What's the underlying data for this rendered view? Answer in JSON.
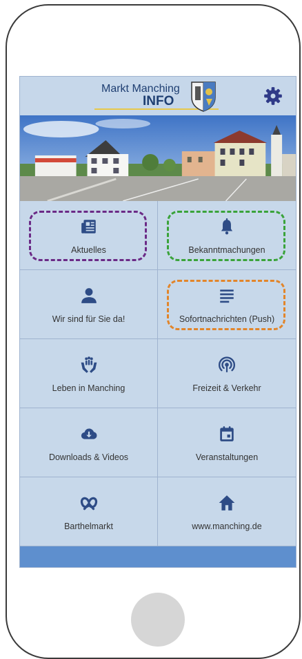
{
  "header": {
    "title_line1": "Markt Manching",
    "title_line2": "INFO"
  },
  "colors": {
    "header_bg": "#c6d7ea",
    "tile_bg": "#c7d8ea",
    "icon_color": "#2e4c86",
    "footer_bar": "#5e8fce",
    "highlight_purple": "#6b2a86",
    "highlight_green": "#3aa33a",
    "highlight_orange": "#e2852a"
  },
  "tiles": [
    {
      "label": "Aktuelles",
      "icon": "newspaper-icon",
      "highlight": "purple"
    },
    {
      "label": "Bekanntmachungen",
      "icon": "bell-icon",
      "highlight": "green"
    },
    {
      "label": "Wir sind für Sie da!",
      "icon": "person-icon",
      "highlight": ""
    },
    {
      "label": "Sofortnachrichten (Push)",
      "icon": "text-lines-icon",
      "highlight": "orange"
    },
    {
      "label": "Leben in Manching",
      "icon": "caring-hands-icon",
      "highlight": ""
    },
    {
      "label": "Freizeit & Verkehr",
      "icon": "radio-signal-icon",
      "highlight": ""
    },
    {
      "label": "Downloads & Videos",
      "icon": "cloud-download-icon",
      "highlight": ""
    },
    {
      "label": "Veranstaltungen",
      "icon": "calendar-icon",
      "highlight": ""
    },
    {
      "label": "Barthelmarkt",
      "icon": "pretzel-icon",
      "highlight": ""
    },
    {
      "label": "www.manching.de",
      "icon": "home-icon",
      "highlight": ""
    }
  ]
}
